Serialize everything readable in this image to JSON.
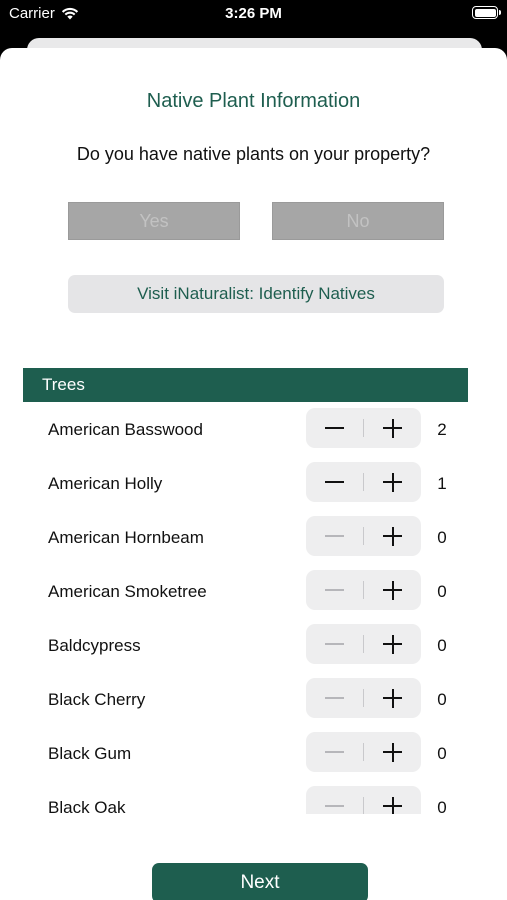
{
  "status_bar": {
    "carrier": "Carrier",
    "time": "3:26 PM"
  },
  "header": {
    "title": "Native Plant Information",
    "question": "Do you have native plants on your property?"
  },
  "buttons": {
    "yes_label": "Yes",
    "no_label": "No",
    "inaturalist_label": "Visit iNaturalist: Identify Natives",
    "next_label": "Next"
  },
  "section": {
    "title": "Trees"
  },
  "plants": [
    {
      "name": "American Basswood",
      "count": "2"
    },
    {
      "name": "American Holly",
      "count": "1"
    },
    {
      "name": "American Hornbeam",
      "count": "0"
    },
    {
      "name": "American Smoketree",
      "count": "0"
    },
    {
      "name": "Baldcypress",
      "count": "0"
    },
    {
      "name": "Black Cherry",
      "count": "0"
    },
    {
      "name": "Black Gum",
      "count": "0"
    },
    {
      "name": "Black Oak",
      "count": "0"
    }
  ],
  "colors": {
    "accent": "#1e5e4f",
    "disabled_button": "#a6a6a6"
  }
}
